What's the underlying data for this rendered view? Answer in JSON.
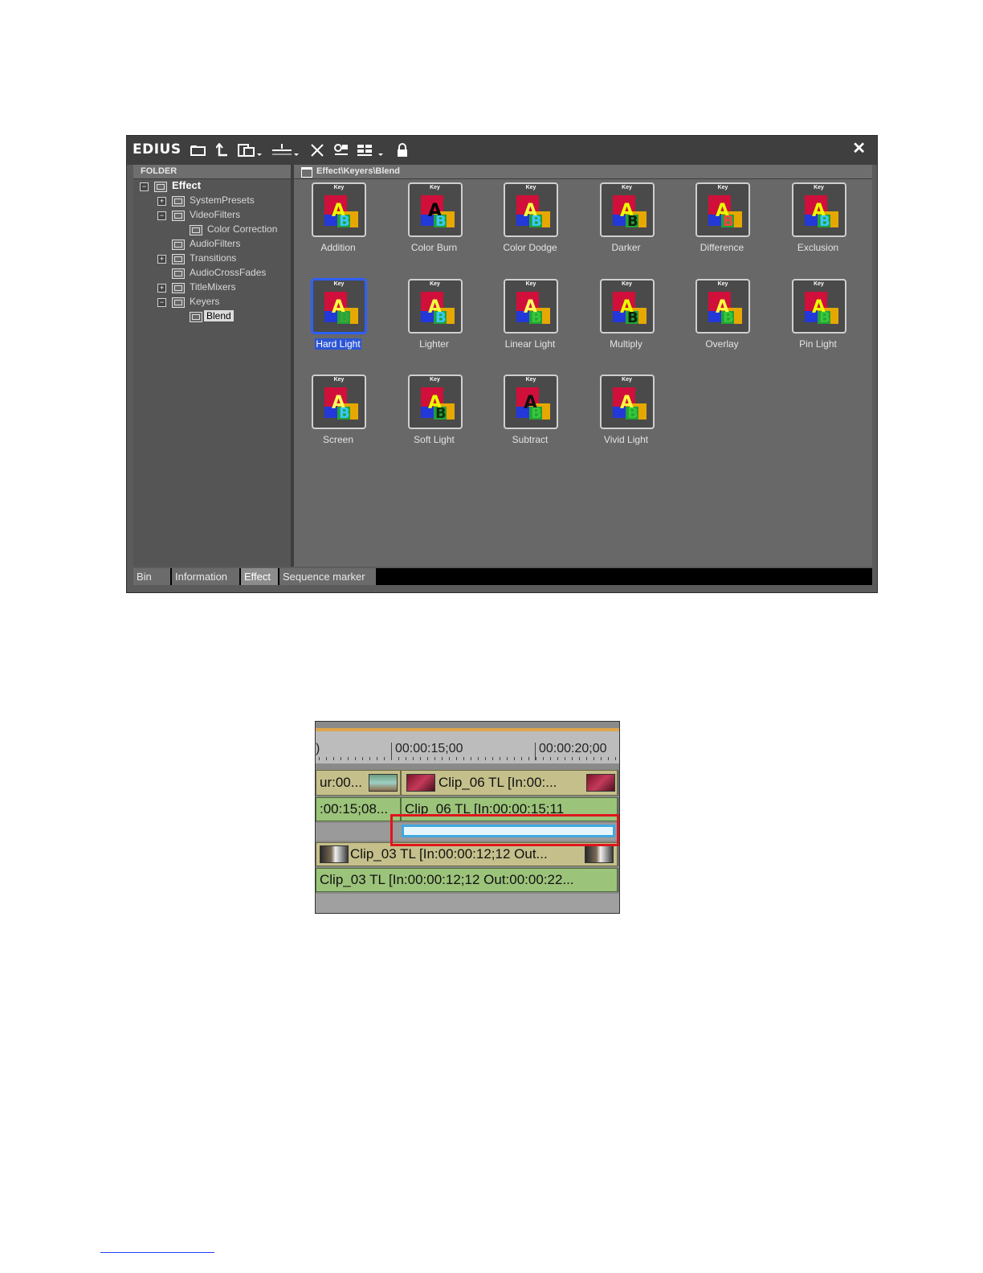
{
  "palette": {
    "app_title": "EDIUS",
    "toolbar_icons": [
      "new-folder-icon",
      "up-folder-icon",
      "paste-icon",
      "import-icon",
      "delete-icon",
      "properties-icon",
      "view-icon",
      "lock-icon"
    ],
    "close_label": "✕",
    "folder_header": "FOLDER",
    "path": "Effect\\Keyers\\Blend",
    "tree": {
      "effect": "Effect",
      "system_presets": "SystemPresets",
      "video_filters": "VideoFilters",
      "color_correction": "Color Correction",
      "audio_filters": "AudioFilters",
      "transitions": "Transitions",
      "audio_cross_fades": "AudioCrossFades",
      "title_mixers": "TitleMixers",
      "keyers": "Keyers",
      "blend": "Blend"
    },
    "thumb_key": "Key",
    "effects": [
      "Addition",
      "Color Burn",
      "Color Dodge",
      "Darker",
      "Difference",
      "Exclusion",
      "Hard Light",
      "Lighter",
      "Linear Light",
      "Multiply",
      "Overlay",
      "Pin Light",
      "Screen",
      "Soft Light",
      "Subtract",
      "Vivid Light"
    ],
    "selected_effect": "Hard Light",
    "tabs": [
      "Bin",
      "Information",
      "Effect",
      "Sequence marker"
    ],
    "active_tab": "Effect"
  },
  "timeline": {
    "ruler_left": ")",
    "ruler_1": "00:00:15;00",
    "ruler_2": "00:00:20;00",
    "track1_left": "ur:00...",
    "track1_clip": "Clip_06  TL  [In:00:...",
    "track2_left": ":00:15;08...",
    "track2_clip": "Clip_06  TL  [In:00:00:15;11",
    "track4_clip": "Clip_03  TL  [In:00:00:12;12 Out...",
    "track5_clip": "Clip_03  TL  [In:00:00:12;12 Out:00:00:22..."
  },
  "colors": {
    "highlight": "#e0151e",
    "mix_bar": "#3fa8e0",
    "selection": "#2b55d6"
  }
}
